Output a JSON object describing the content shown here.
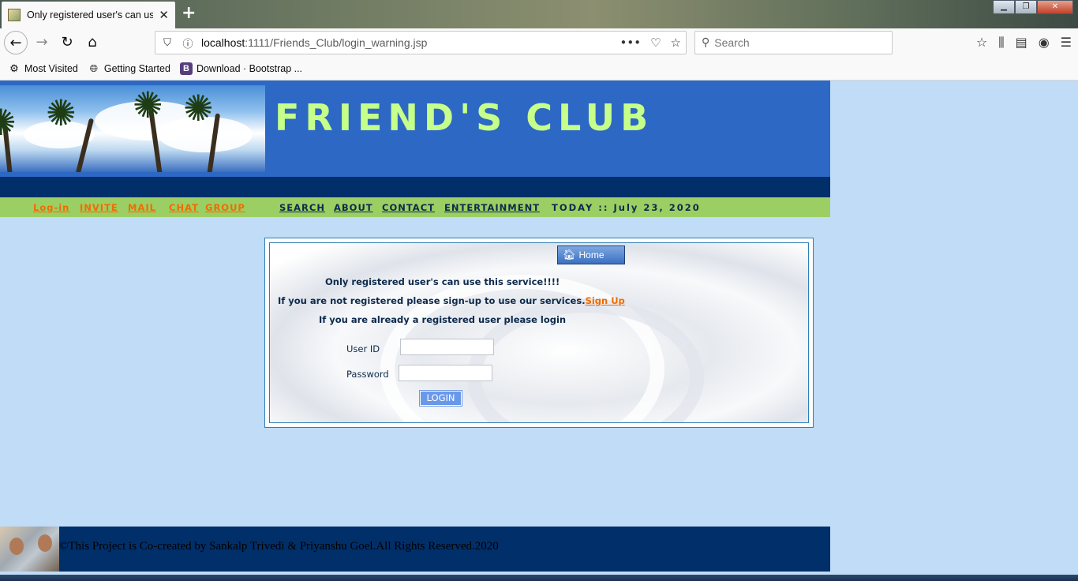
{
  "browser": {
    "tab_title": "Only registered user's can use t",
    "url_host": "localhost",
    "url_path": ":1111/Friends_Club/login_warning.jsp",
    "search_placeholder": "Search",
    "bookmarks": [
      {
        "label": "Most Visited",
        "icon": "gear-icon"
      },
      {
        "label": "Getting Started",
        "icon": "globe-icon"
      },
      {
        "label": "Download · Bootstrap ...",
        "icon": "bootstrap-icon"
      }
    ]
  },
  "site": {
    "title": "FRIEND'S CLUB",
    "menu_left": [
      "Log-in",
      "INVITE",
      "MAIL",
      "CHAT",
      "GROUP"
    ],
    "menu_right": [
      "SEARCH",
      "ABOUT",
      "CONTACT",
      "ENTERTAINMENT"
    ],
    "today_label": "TODAY :: July 23, 2020"
  },
  "login": {
    "home_label": "Home",
    "msg1": "Only registered user's can use this service!!!!",
    "msg2": "If you are not registered please sign-up to use our services.",
    "signup_link": "Sign Up",
    "msg3": "If you are already a registered user please login",
    "userid_label": "User ID",
    "password_label": "Password",
    "userid_value": "",
    "password_value": "",
    "login_button": "LOGIN"
  },
  "footer": {
    "text": "©This Project is Co-created by Sankalp Trivedi & Priyanshu Goel.All Rights Reserved.2020"
  },
  "colors": {
    "page_bg": "#c0dcf7",
    "header_blue": "#2d68c4",
    "title_green": "#c6ff8a",
    "menu_green": "#9ccf63",
    "link_orange": "#f06c00",
    "navy": "#012f6a"
  }
}
